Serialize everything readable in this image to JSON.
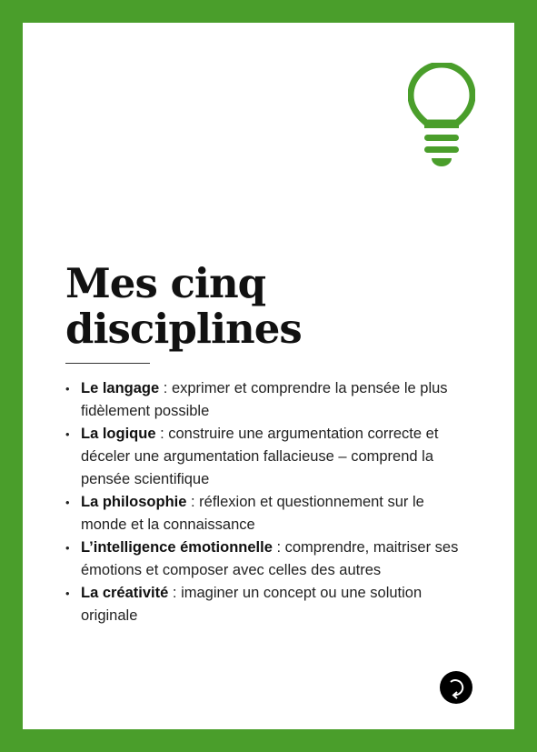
{
  "title_line1": "Mes cinq",
  "title_line2": "disciplines",
  "accent_color": "#4a9e2b",
  "icons": {
    "header": "lightbulb-icon",
    "footer": "rotate-arrow-icon"
  },
  "items": [
    {
      "term": "Le langage",
      "text": " : exprimer et comprendre la pensée le plus fidèlement possible"
    },
    {
      "term": "La logique",
      "text": " : construire une argumentation correcte et déceler une argumentation fallacieuse – comprend la pensée scientifique"
    },
    {
      "term": "La philosophie",
      "text": " : réflexion et questionnement sur le monde et la connaissance"
    },
    {
      "term": "L’intelligence émotionnelle",
      "text": " : comprendre, maitriser ses émotions et composer avec celles des autres"
    },
    {
      "term": "La créativité",
      "text": " : imaginer un concept ou une solution originale"
    }
  ]
}
